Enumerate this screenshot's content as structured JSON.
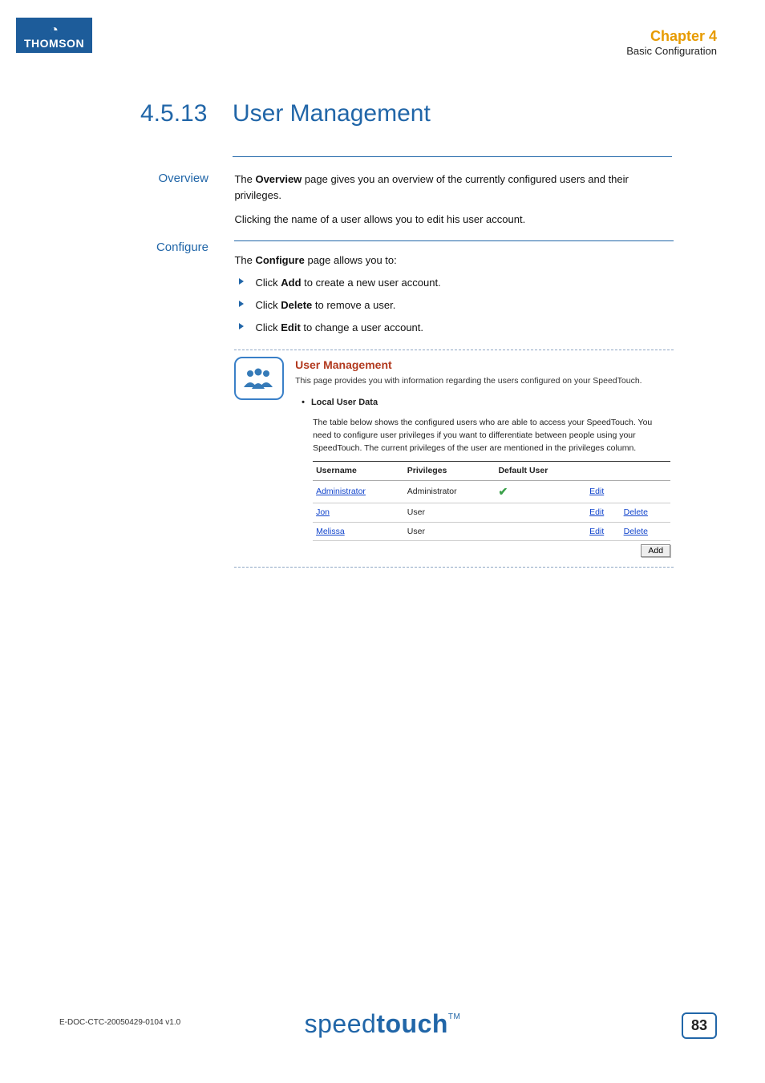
{
  "brand": {
    "name": "THOMSON"
  },
  "header": {
    "chapter": "Chapter 4",
    "subtitle": "Basic Configuration"
  },
  "section": {
    "number": "4.5.13",
    "title": "User Management"
  },
  "overview": {
    "label": "Overview",
    "p1a": "The ",
    "p1b": "Overview",
    "p1c": " page gives you an overview of the currently configured users and their privileges.",
    "p2": "Clicking the name of a user allows you to edit his user account."
  },
  "configure": {
    "label": "Configure",
    "leadA": "The ",
    "leadB": "Configure",
    "leadC": " page allows you to:",
    "items": [
      {
        "a": "Click ",
        "b": "Add",
        "c": " to create a new user account."
      },
      {
        "a": "Click ",
        "b": "Delete",
        "c": " to remove a user."
      },
      {
        "a": "Click ",
        "b": "Edit",
        "c": " to change a user account."
      }
    ]
  },
  "ss": {
    "title": "User Management",
    "subtitle": "This page provides you with information regarding the users configured on your SpeedTouch.",
    "section": "Local User Data",
    "desc": "The table below shows the configured users who are able to access your SpeedTouch. You need to configure user privileges if you want to differentiate between people using your SpeedTouch. The current privileges of the user are mentioned in the privileges column.",
    "cols": {
      "c1": "Username",
      "c2": "Privileges",
      "c3": "Default User"
    },
    "rows": [
      {
        "user": "Administrator",
        "priv": "Administrator",
        "def": true,
        "edit": "Edit",
        "del": ""
      },
      {
        "user": "Jon",
        "priv": "User",
        "def": false,
        "edit": "Edit",
        "del": "Delete"
      },
      {
        "user": "Melissa",
        "priv": "User",
        "def": false,
        "edit": "Edit",
        "del": "Delete"
      }
    ],
    "add": "Add"
  },
  "footer": {
    "docid": "E-DOC-CTC-20050429-0104 v1.0",
    "logoA": "speed",
    "logoB": "touch",
    "tm": "TM",
    "page": "83"
  }
}
